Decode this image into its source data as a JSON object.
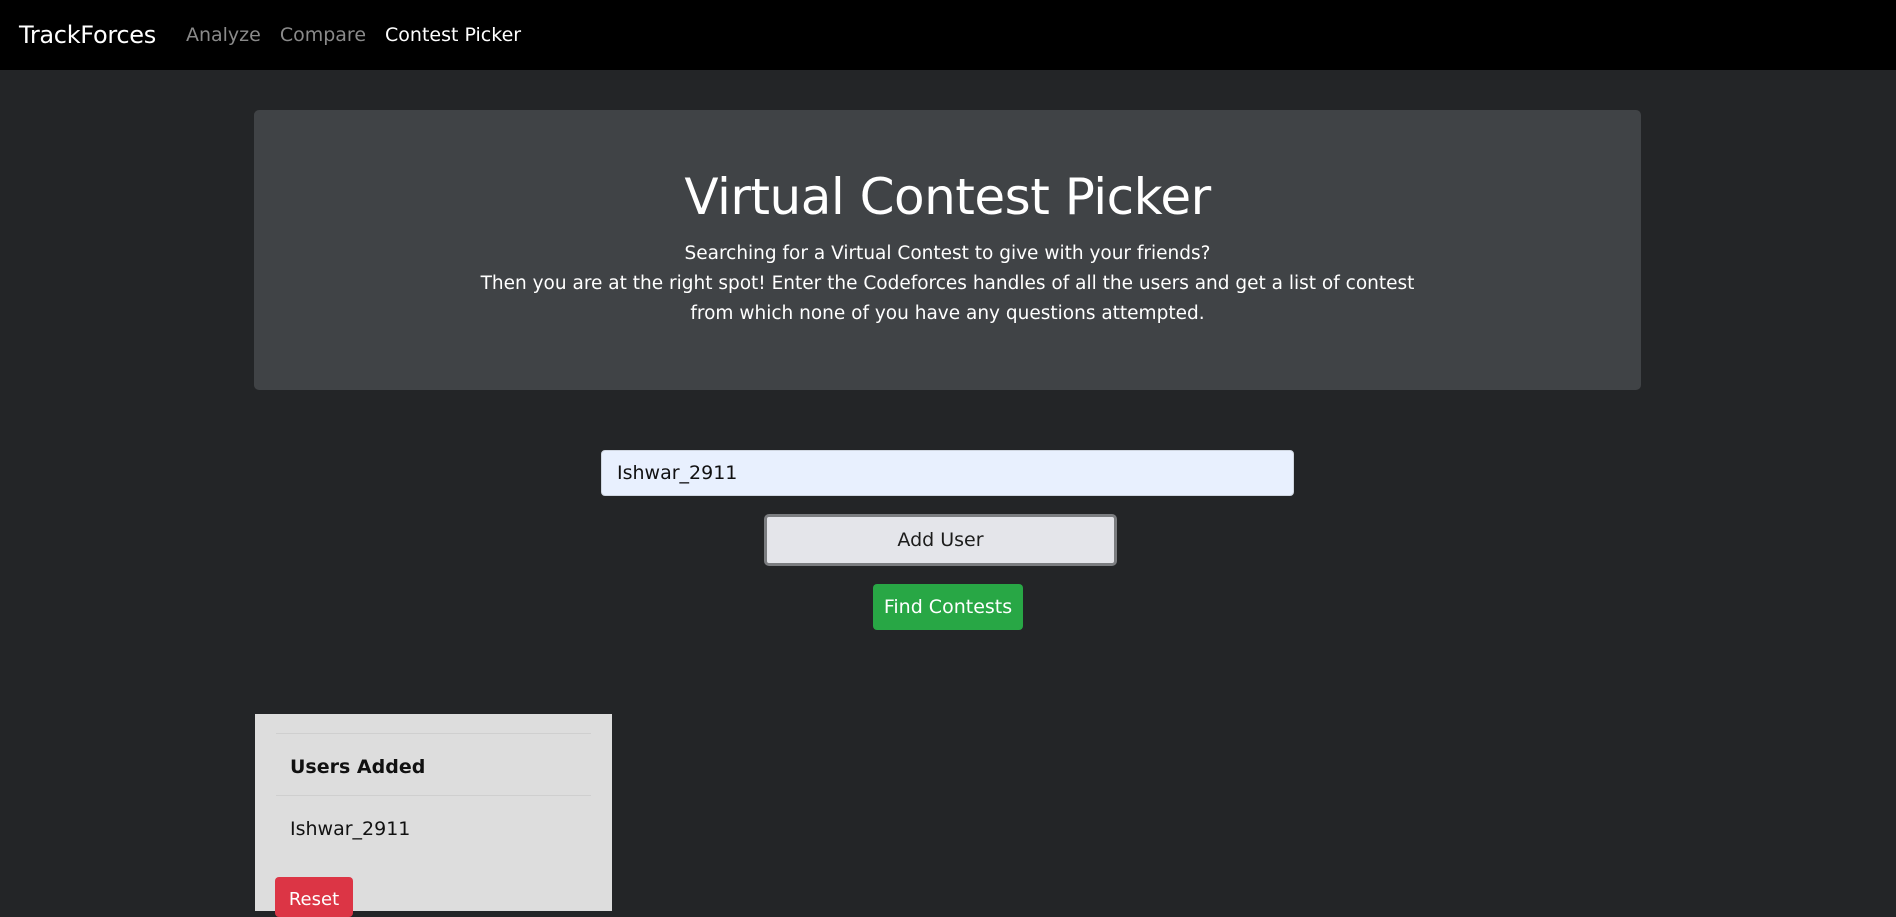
{
  "navbar": {
    "brand": "TrackForces",
    "links": [
      {
        "label": "Analyze",
        "active": false
      },
      {
        "label": "Compare",
        "active": false
      },
      {
        "label": "Contest Picker",
        "active": true
      }
    ]
  },
  "hero": {
    "title": "Virtual Contest Picker",
    "lines": [
      "Searching for a Virtual Contest to give with your friends?",
      "Then you are at the right spot! Enter the Codeforces handles of all the users and get a list of contest",
      "from which none of you have any questions attempted."
    ]
  },
  "form": {
    "handle_value": "Ishwar_2911",
    "add_user_label": "Add User",
    "find_contests_label": "Find Contests"
  },
  "users_panel": {
    "header": "Users Added",
    "users": [
      "Ishwar_2911"
    ],
    "reset_label": "Reset"
  },
  "colors": {
    "background": "#232527",
    "navbar": "#000000",
    "hero": "#404346",
    "success": "#28a745",
    "danger": "#dc3545",
    "input_autofill": "#e8f0fe",
    "panel": "#dddddd"
  }
}
